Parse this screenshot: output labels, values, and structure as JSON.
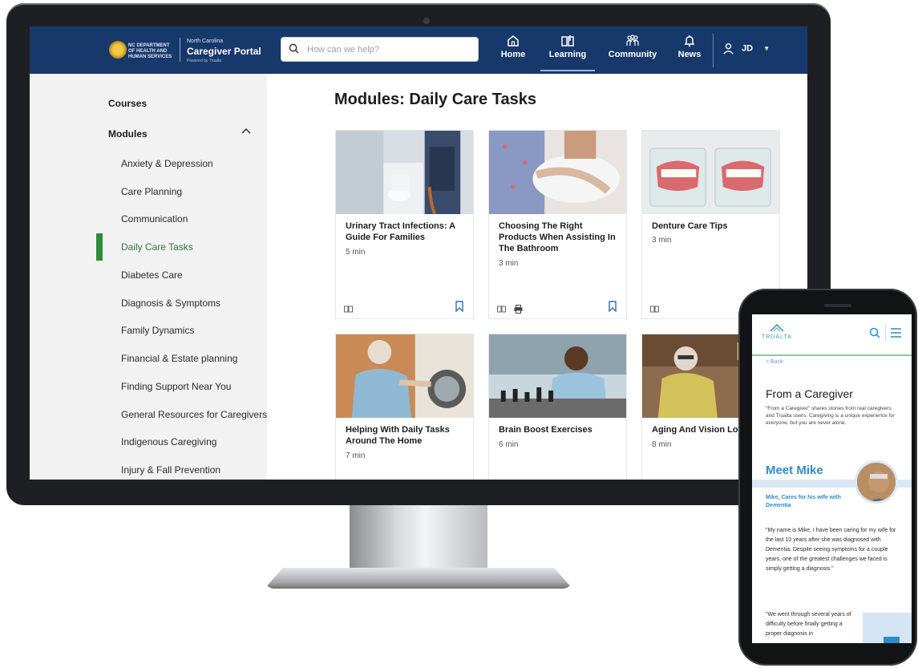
{
  "header": {
    "dept_name": "NC DEPARTMENT OF HEALTH AND HUMAN SERVICES",
    "brand_state": "North Carolina",
    "brand_title": "Caregiver Portal",
    "brand_tagline": "Powered by Trualta",
    "search_placeholder": "How can we help?",
    "nav": [
      {
        "label": "Home",
        "icon": "home-icon"
      },
      {
        "label": "Learning",
        "icon": "book-icon",
        "active": true
      },
      {
        "label": "Community",
        "icon": "people-icon"
      },
      {
        "label": "News",
        "icon": "bell-icon"
      }
    ],
    "user_initials": "JD",
    "brand_color": "#17386b"
  },
  "sidebar": {
    "courses_label": "Courses",
    "modules_label": "Modules",
    "items": [
      "Anxiety & Depression",
      "Care Planning",
      "Communication",
      "Daily Care Tasks",
      "Diabetes Care",
      "Diagnosis & Symptoms",
      "Family Dynamics",
      "Financial & Estate planning",
      "Finding Support Near You",
      "General Resources for Caregivers",
      "Indigenous Caregiving",
      "Injury & Fall Prevention"
    ],
    "active_item": "Daily Care Tasks",
    "active_color": "#2e8b3a"
  },
  "main": {
    "title": "Modules: Daily Care Tasks",
    "cards": [
      {
        "title": "Urinary Tract Infections: A Guide For Families",
        "duration": "5 min"
      },
      {
        "title": "Choosing The Right Products When Assisting In The Bathroom",
        "duration": "3 min"
      },
      {
        "title": "Denture Care Tips",
        "duration": "3 min"
      },
      {
        "title": "Helping With Daily Tasks Around The Home",
        "duration": "7 min"
      },
      {
        "title": "Brain Boost Exercises",
        "duration": "6 min"
      },
      {
        "title": "Aging And Vision Lo",
        "duration": "8 min"
      }
    ]
  },
  "phone": {
    "logo_text": "TRUALTA",
    "back_label": "< Back",
    "title": "From a Caregiver",
    "intro": "\"From a Caregiver\" shares stories from real caregivers and Trualta users. Caregiving is a unique experience for everyone, but you are never alone.",
    "meet_title": "Meet Mike",
    "subtitle": "Mike, Cares for his wife with Dementia",
    "quote1": "\"My name is Mike, I have been caring for my wife for the last 10 years after she was diagnosed with Dementia. Despite seeing symptoms for a couple years, one of the greatest challenges we faced is simply getting a diagnosis.\"",
    "quote2": "\"We went through several years of difficulty before finally getting a proper diagnosis in",
    "accent_color": "#2f8ccb"
  }
}
